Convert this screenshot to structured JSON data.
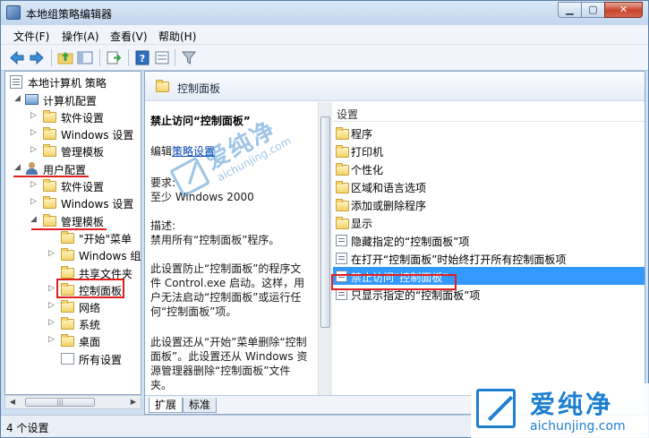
{
  "window": {
    "title": "本地组策略编辑器",
    "buttons": {
      "minimize": "▁",
      "maximize": "▢",
      "close": "✕"
    }
  },
  "menu": [
    "文件(F)",
    "操作(A)",
    "查看(V)",
    "帮助(H)"
  ],
  "toolbar": {
    "icons": [
      "back-arrow-icon",
      "forward-arrow-icon",
      "up-folder-icon",
      "show-tree-icon",
      "export-list-icon",
      "help-icon",
      "properties-icon",
      "filter-icon"
    ]
  },
  "tree": {
    "root": "本地计算机 策略",
    "computer_config": "计算机配置",
    "cc_software": "软件设置",
    "cc_windows": "Windows 设置",
    "cc_admin": "管理模板",
    "user_config": "用户配置",
    "uc_software": "软件设置",
    "uc_windows": "Windows 设置",
    "uc_admin": "管理模板",
    "start_menu": "\"开始\"菜单",
    "windows_components": "Windows 组件",
    "shared_folders": "共享文件夹",
    "control_panel": "控制面板",
    "network": "网络",
    "system": "系统",
    "desktop": "桌面",
    "all_settings": "所有设置"
  },
  "right": {
    "path_title": "控制面板",
    "description": {
      "policy_title": "禁止访问“控制面板”",
      "edit_prefix": "编辑",
      "edit_link": "策略设置",
      "requirements_label": "要求:",
      "requirements": "至少 Windows 2000",
      "desc_label": "描述:",
      "desc_1": "禁用所有“控制面板”程序。",
      "desc_2": "此设置防止“控制面板”的程序文件 Control.exe 启动。这样，用户无法启动“控制面板”或运行任何“控制面板”项。",
      "desc_3": "此设置还从“开始”菜单删除“控制面板”。此设置还从 Windows 资源管理器删除“控制面板”文件夹。"
    },
    "settings_header": "设置",
    "settings": [
      {
        "type": "folder",
        "label": "程序"
      },
      {
        "type": "folder",
        "label": "打印机"
      },
      {
        "type": "folder",
        "label": "个性化"
      },
      {
        "type": "folder",
        "label": "区域和语言选项"
      },
      {
        "type": "folder",
        "label": "添加或删除程序"
      },
      {
        "type": "folder",
        "label": "显示"
      },
      {
        "type": "setting",
        "label": "隐藏指定的“控制面板”项"
      },
      {
        "type": "setting",
        "label": "在打开“控制面板”时始终打开所有控制面板项"
      },
      {
        "type": "setting",
        "label": "禁止访问“控制面板”",
        "selected": true
      },
      {
        "type": "setting",
        "label": "只显示指定的“控制面板”项"
      }
    ],
    "tabs": [
      "扩展",
      "标准"
    ]
  },
  "status": "4 个设置",
  "watermark": {
    "brand_cn": "爱纯净",
    "brand_url": "aichunjing.com"
  },
  "colors": {
    "selection": "#3399ff",
    "annotation_red": "#e0201f",
    "link": "#0645ad",
    "watermark_blue": "#1f7fd1"
  }
}
